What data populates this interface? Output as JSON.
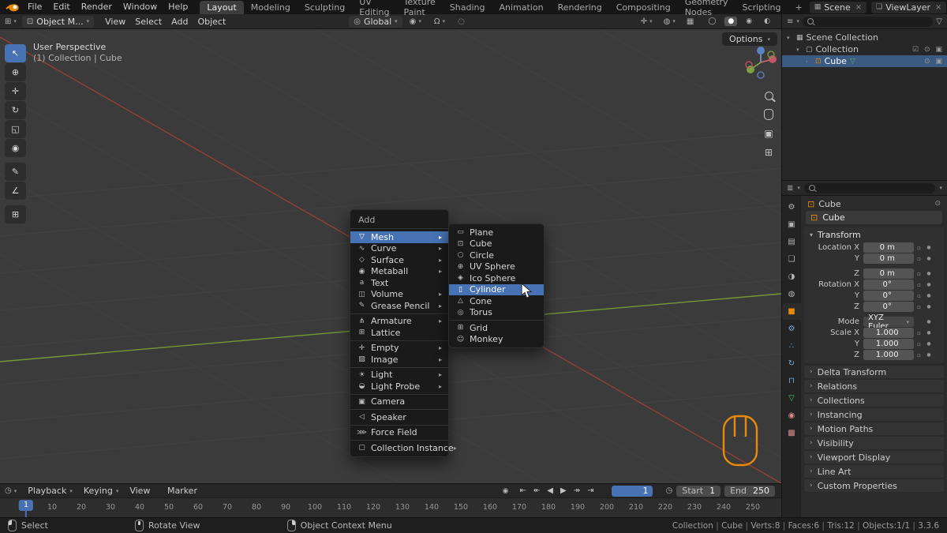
{
  "icons": {
    "caret_down": "▾",
    "submenu_arrow": "▸",
    "collapse_open": "▾",
    "collapse_closed": "›",
    "funnel": "▽",
    "close": "×",
    "checkbox": "☑",
    "eye": "⊙",
    "camera": "▣",
    "editor_viewport": "⊞",
    "editor_outliner": "≡",
    "editor_properties": "≣",
    "editor_timeline": "◷",
    "object_mode": "⊡",
    "orientation": "◎",
    "pivot": "◉",
    "magnet": "Ω",
    "proportional": "◌",
    "gizmo_toggle": "✛",
    "overlays": "◍",
    "xray": "▦",
    "lock": "▫",
    "decorate": "●",
    "pin": "⊙",
    "scene": "▦",
    "viewlayer": "❏",
    "scene_collection": "▦",
    "collection": "▢",
    "cube_object": "⊡",
    "mesh_data": "▽",
    "autokey": "◉",
    "clock": "◷",
    "grid_ortho": "⊞",
    "camera_view": "▣"
  },
  "colors": {
    "accent_blue": "#4772b3",
    "object_orange": "#e8890c",
    "mesh_green": "#55b860"
  },
  "topbar": {
    "menus": [
      "File",
      "Edit",
      "Render",
      "Window",
      "Help"
    ],
    "workspaces": [
      {
        "label": "Layout",
        "active": true
      },
      {
        "label": "Modeling"
      },
      {
        "label": "Sculpting"
      },
      {
        "label": "UV Editing"
      },
      {
        "label": "Texture Paint"
      },
      {
        "label": "Shading"
      },
      {
        "label": "Animation"
      },
      {
        "label": "Rendering"
      },
      {
        "label": "Compositing"
      },
      {
        "label": "Geometry Nodes"
      },
      {
        "label": "Scripting"
      },
      {
        "label": "+"
      }
    ],
    "scene_label": "Scene",
    "viewlayer_label": "ViewLayer"
  },
  "viewport_header": {
    "mode_label": "Object M...",
    "menus": [
      "View",
      "Select",
      "Add",
      "Object"
    ],
    "orientation_label": "Global",
    "shading_modes": [
      {
        "name": "wireframe-shading-button",
        "icon": "◯"
      },
      {
        "name": "solid-shading-button",
        "icon": "●",
        "active": true
      },
      {
        "name": "material-preview-shading-button",
        "icon": "◉"
      },
      {
        "name": "rendered-shading-button",
        "icon": "◐"
      }
    ]
  },
  "viewport": {
    "options_label": "Options",
    "perspective_label": "User Perspective",
    "context_label": "(1) Collection | Cube"
  },
  "toolbar": [
    {
      "name": "tweak-select-tool",
      "icon": "↖",
      "active": true
    },
    {
      "name": "cursor-tool",
      "icon": "⊕"
    },
    {
      "name": "move-tool",
      "icon": "✛"
    },
    {
      "name": "rotate-tool",
      "icon": "↻"
    },
    {
      "name": "scale-tool",
      "icon": "◱"
    },
    {
      "name": "transform-tool",
      "icon": "◉"
    },
    {
      "name": "annotate-tool",
      "icon": "✎"
    },
    {
      "name": "measure-tool",
      "icon": "∠"
    },
    {
      "name": "add-primitive-tool",
      "icon": "⊞"
    }
  ],
  "add_menu": {
    "title": "Add",
    "items": [
      {
        "name": "menu-item-mesh",
        "label": "Mesh",
        "icon": "▽",
        "submenu": true,
        "highlighted": true
      },
      {
        "name": "menu-item-curve",
        "label": "Curve",
        "icon": "∿",
        "submenu": true
      },
      {
        "name": "menu-item-surface",
        "label": "Surface",
        "icon": "◇",
        "submenu": true
      },
      {
        "name": "menu-item-metaball",
        "label": "Metaball",
        "icon": "◉",
        "submenu": true
      },
      {
        "name": "menu-item-text",
        "label": "Text",
        "icon": "a"
      },
      {
        "name": "menu-item-volume",
        "label": "Volume",
        "icon": "◫",
        "submenu": true
      },
      {
        "name": "menu-item-grease-pencil",
        "label": "Grease Pencil",
        "icon": "✎",
        "submenu": true,
        "sep_after": true
      },
      {
        "name": "menu-item-armature",
        "label": "Armature",
        "icon": "⋔",
        "submenu": true
      },
      {
        "name": "menu-item-lattice",
        "label": "Lattice",
        "icon": "⊞",
        "sep_after": true
      },
      {
        "name": "menu-item-empty",
        "label": "Empty",
        "icon": "✛",
        "submenu": true
      },
      {
        "name": "menu-item-image",
        "label": "Image",
        "icon": "▨",
        "submenu": true,
        "sep_after": true
      },
      {
        "name": "menu-item-light",
        "label": "Light",
        "icon": "☀",
        "submenu": true
      },
      {
        "name": "menu-item-light-probe",
        "label": "Light Probe",
        "icon": "◒",
        "submenu": true,
        "sep_after": true
      },
      {
        "name": "menu-item-camera",
        "label": "Camera",
        "icon": "▣",
        "sep_after": true
      },
      {
        "name": "menu-item-speaker",
        "label": "Speaker",
        "icon": "◁",
        "sep_after": true
      },
      {
        "name": "menu-item-force-field",
        "label": "Force Field",
        "icon": "⋙",
        "sep_after": true
      },
      {
        "name": "menu-item-collection-instance",
        "label": "Collection Instance",
        "icon": "▢",
        "submenu": true
      }
    ]
  },
  "mesh_submenu": {
    "items": [
      {
        "name": "menu-item-plane",
        "label": "Plane",
        "icon": "▭"
      },
      {
        "name": "menu-item-cube",
        "label": "Cube",
        "icon": "⊡"
      },
      {
        "name": "menu-item-circle",
        "label": "Circle",
        "icon": "○"
      },
      {
        "name": "menu-item-uv-sphere",
        "label": "UV Sphere",
        "icon": "⊕"
      },
      {
        "name": "menu-item-ico-sphere",
        "label": "Ico Sphere",
        "icon": "◈"
      },
      {
        "name": "menu-item-cylinder",
        "label": "Cylinder",
        "icon": "▯",
        "highlighted": true
      },
      {
        "name": "menu-item-cone",
        "label": "Cone",
        "icon": "△"
      },
      {
        "name": "menu-item-torus",
        "label": "Torus",
        "icon": "◎",
        "sep_after": true
      },
      {
        "name": "menu-item-grid",
        "label": "Grid",
        "icon": "⊞"
      },
      {
        "name": "menu-item-monkey",
        "label": "Monkey",
        "icon": "☺"
      }
    ]
  },
  "outliner": {
    "rows": [
      {
        "label": "Scene Collection"
      },
      {
        "label": "Collection"
      },
      {
        "label": "Cube"
      }
    ]
  },
  "properties": {
    "tabs": [
      {
        "name": "tool-tab",
        "icon": "⚙",
        "color": "#b4b4b4"
      },
      {
        "name": "render-tab",
        "icon": "▣",
        "color": "#b4b4b4"
      },
      {
        "name": "output-tab",
        "icon": "▤",
        "color": "#b4b4b4"
      },
      {
        "name": "view-layer-tab",
        "icon": "❏",
        "color": "#b4b4b4"
      },
      {
        "name": "scene-tab",
        "icon": "◑",
        "color": "#b4b4b4"
      },
      {
        "name": "world-tab",
        "icon": "◍",
        "color": "#b4b4b4"
      },
      {
        "name": "object-tab",
        "icon": "■",
        "color": "#e8890c",
        "active": true
      },
      {
        "name": "modifiers-tab",
        "icon": "⚙",
        "color": "#7ea7d8"
      },
      {
        "name": "particles-tab",
        "icon": "∴",
        "color": "#7ea7d8"
      },
      {
        "name": "physics-tab",
        "icon": "↻",
        "color": "#7ea7d8"
      },
      {
        "name": "constraints-tab",
        "icon": "⊓",
        "color": "#7ea7d8"
      },
      {
        "name": "object-data-tab",
        "icon": "▽",
        "color": "#4fbf77"
      },
      {
        "name": "material-tab",
        "icon": "◉",
        "color": "#d88a8a"
      },
      {
        "name": "texture-tab",
        "icon": "▩",
        "color": "#d88a8a"
      }
    ],
    "breadcrumb": "Cube",
    "object_name": "Cube",
    "transform": {
      "title": "Transform",
      "rows": [
        {
          "label": "Location X",
          "value": "0 m",
          "lock": true,
          "dot": true
        },
        {
          "label": "Y",
          "value": "0 m",
          "lock": true,
          "dot": true
        },
        {
          "label": "Z",
          "value": "0 m",
          "lock": true,
          "dot": true
        },
        {
          "label": "Rotation X",
          "value": "0°",
          "lock": true,
          "dot": true
        },
        {
          "label": "Y",
          "value": "0°",
          "lock": true,
          "dot": true
        },
        {
          "label": "Z",
          "value": "0°",
          "lock": true,
          "dot": true
        },
        {
          "label": "Mode",
          "value": "XYZ Euler",
          "dropdown": true,
          "dot": true
        },
        {
          "label": "Scale X",
          "value": "1.000",
          "lock": true,
          "dot": true
        },
        {
          "label": "Y",
          "value": "1.000",
          "lock": true,
          "dot": true
        },
        {
          "label": "Z",
          "value": "1.000",
          "lock": true,
          "dot": true
        }
      ]
    },
    "panels": [
      "Delta Transform",
      "Relations",
      "Collections",
      "Instancing",
      "Motion Paths",
      "Visibility",
      "Viewport Display",
      "Line Art",
      "Custom Properties"
    ]
  },
  "timeline": {
    "menus": [
      {
        "label": "Playback",
        "caret": true
      },
      {
        "label": "Keying",
        "caret": true
      },
      {
        "label": "View"
      },
      {
        "label": "Marker"
      }
    ],
    "playback": [
      {
        "name": "jump-to-start-button",
        "icon": "⇤"
      },
      {
        "name": "previous-keyframe-button",
        "icon": "↞"
      },
      {
        "name": "play-reverse-button",
        "icon": "◀"
      },
      {
        "name": "play-button",
        "icon": "▶"
      },
      {
        "name": "next-keyframe-button",
        "icon": "↠"
      },
      {
        "name": "jump-to-end-button",
        "icon": "⇥"
      }
    ],
    "current_frame": "1",
    "start_label": "Start",
    "start_value": "1",
    "end_label": "End",
    "end_value": "250",
    "ticks": [
      10,
      20,
      30,
      40,
      50,
      60,
      70,
      80,
      90,
      100,
      110,
      120,
      130,
      140,
      150,
      160,
      170,
      180,
      190,
      200,
      210,
      220,
      230,
      240,
      250
    ]
  },
  "statusbar": {
    "hints": [
      {
        "variant": "left",
        "label": "Select"
      },
      {
        "variant": "middle",
        "label": "Rotate View"
      },
      {
        "variant": "right",
        "label": "Object Context Menu"
      }
    ],
    "info": [
      "Collection",
      "Cube",
      "Verts:8",
      "Faces:6",
      "Tris:12",
      "Objects:1/1",
      "3.3.6"
    ]
  }
}
